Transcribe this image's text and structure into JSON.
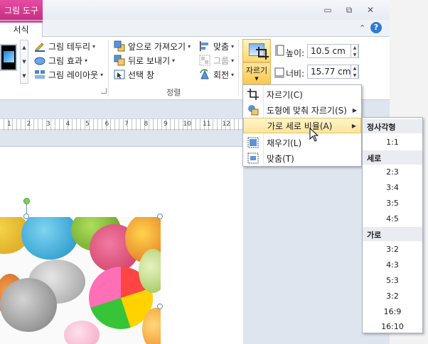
{
  "window": {
    "contextual_tab": "그림 도구",
    "minimize_glyph": "▭",
    "restore_glyph": "⧉",
    "close_glyph": "✕"
  },
  "tabs": {
    "active": "서식",
    "help_glyph": "?",
    "collapse_glyph": "⌃"
  },
  "ribbon": {
    "styles": {
      "border": "그림 테두리",
      "effects": "그림 효과",
      "layout": "그림 레이아웃"
    },
    "arrange": {
      "bring_forward": "앞으로 가져오기",
      "send_backward": "뒤로 보내기",
      "selection_pane": "선택 창",
      "align": "맞춤",
      "group": "그룹",
      "rotate": "회전",
      "group_label": "정렬"
    },
    "size": {
      "crop_label": "자르기",
      "height_label": "높이:",
      "height_value": "10.5 cm",
      "width_label": "너비:",
      "width_value": "15.77 cm"
    }
  },
  "ruler": {
    "labels": [
      "1",
      "2",
      "3",
      "4",
      "5",
      "6",
      "7",
      "8",
      "9",
      "10",
      "11",
      "12"
    ]
  },
  "crop_menu": {
    "items": [
      {
        "label": "자르기(C)"
      },
      {
        "label": "도형에 맞춰 자르기(S)"
      },
      {
        "label": "가로 세로 비율(A)"
      },
      {
        "label": "채우기(L)"
      },
      {
        "label": "맞춤(T)"
      }
    ]
  },
  "ratio_menu": {
    "square_header": "정사각형",
    "square": [
      "1:1"
    ],
    "portrait_header": "세로",
    "portrait": [
      "2:3",
      "3:4",
      "3:5",
      "4:5"
    ],
    "landscape_header": "가로",
    "landscape": [
      "3:2",
      "4:3",
      "5:3",
      "3:2",
      "16:9",
      "16:10"
    ]
  },
  "colors": {
    "contextual_pink": "#d84a98",
    "highlight": "#fde59a",
    "help_blue": "#2f7bd3"
  }
}
